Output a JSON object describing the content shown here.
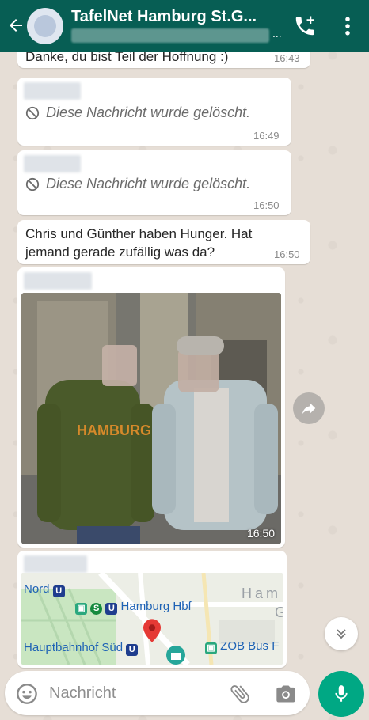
{
  "header": {
    "title": "TafelNet Hamburg St.G...",
    "subtitle_suffix": "..."
  },
  "messages": {
    "cut_text": "Danke, du bist Teil der Hoffnung :)",
    "cut_time": "16:43",
    "deleted_1": {
      "text": "Diese Nachricht wurde gelöscht.",
      "time": "16:49"
    },
    "deleted_2": {
      "text": "Diese Nachricht wurde gelöscht.",
      "time": "16:50"
    },
    "text_msg": {
      "text": "Chris und Günther haben Hunger. Hat jemand gerade zufällig was da?",
      "time": "16:50"
    },
    "photo_msg": {
      "time": "16:50",
      "sweater_text": "HAMBURG"
    },
    "map_msg": {
      "labels": {
        "nord": "Nord",
        "hbf": "Hamburg Hbf",
        "sued": "Hauptbahnhof Süd",
        "zob": "ZOB Bus F",
        "ham": "Ham",
        "g": "G"
      },
      "badges": {
        "u": "U",
        "s": "S"
      }
    }
  },
  "input": {
    "placeholder": "Nachricht"
  },
  "colors": {
    "header": "#075e54",
    "accent": "#00a884",
    "map_label": "#1e62b5"
  },
  "icons": [
    "back-arrow-icon",
    "add-call-icon",
    "more-vertical-icon",
    "blocked-icon",
    "forward-icon",
    "chevron-double-down-icon",
    "emoji-icon",
    "attach-icon",
    "camera-icon",
    "mic-icon",
    "map-pin-icon"
  ]
}
